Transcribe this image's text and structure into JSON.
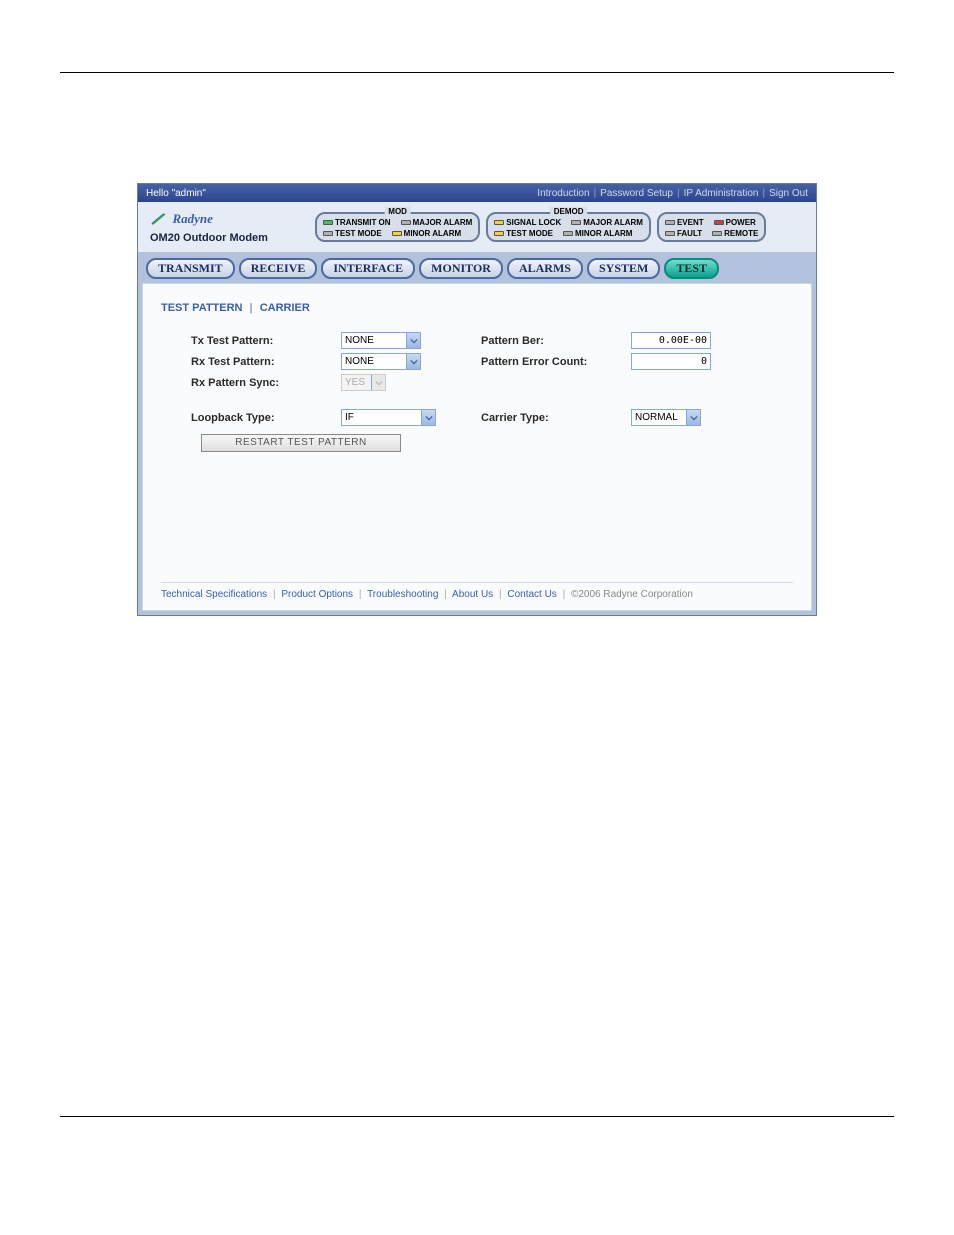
{
  "topbar": {
    "greeting": "Hello \"admin\"",
    "links": [
      "Introduction",
      "Password Setup",
      "IP Administration",
      "Sign Out"
    ]
  },
  "logo": {
    "brand": "Radyne",
    "model": "OM20 Outdoor Modem"
  },
  "status": {
    "mod": {
      "title": "MOD",
      "row1": [
        {
          "label": "TRANSMIT ON",
          "color": "green"
        },
        {
          "label": "MAJOR ALARM",
          "color": "gray"
        }
      ],
      "row2": [
        {
          "label": "TEST MODE",
          "color": "gray"
        },
        {
          "label": "MINOR ALARM",
          "color": "yellow"
        }
      ]
    },
    "demod": {
      "title": "DEMOD",
      "row1": [
        {
          "label": "SIGNAL LOCK",
          "color": "yellow"
        },
        {
          "label": "MAJOR ALARM",
          "color": "gray"
        }
      ],
      "row2": [
        {
          "label": "TEST MODE",
          "color": "yellow"
        },
        {
          "label": "MINOR ALARM",
          "color": "gray"
        }
      ]
    },
    "sys": {
      "row1": [
        {
          "label": "EVENT",
          "color": "gray"
        },
        {
          "label": "POWER",
          "color": "red"
        }
      ],
      "row2": [
        {
          "label": "FAULT",
          "color": "gray"
        },
        {
          "label": "REMOTE",
          "color": "gray"
        }
      ]
    }
  },
  "tabs": [
    "TRANSMIT",
    "RECEIVE",
    "INTERFACE",
    "MONITOR",
    "ALARMS",
    "SYSTEM",
    "TEST"
  ],
  "subtabs": [
    "TEST PATTERN",
    "CARRIER"
  ],
  "form": {
    "txTestPattern": {
      "label": "Tx Test Pattern:",
      "value": "NONE"
    },
    "rxTestPattern": {
      "label": "Rx Test Pattern:",
      "value": "NONE"
    },
    "rxPatternSync": {
      "label": "Rx Pattern Sync:",
      "value": "YES"
    },
    "patternBer": {
      "label": "Pattern Ber:",
      "value": "0.00E-00"
    },
    "patternErrCount": {
      "label": "Pattern Error Count:",
      "value": "0"
    },
    "loopbackType": {
      "label": "Loopback Type:",
      "value": "IF"
    },
    "carrierType": {
      "label": "Carrier Type:",
      "value": "NORMAL"
    },
    "restartBtn": "RESTART TEST PATTERN"
  },
  "footer": {
    "links": [
      "Technical Specifications",
      "Product Options",
      "Troubleshooting",
      "About Us",
      "Contact Us"
    ],
    "copy": "©2006 Radyne Corporation"
  }
}
